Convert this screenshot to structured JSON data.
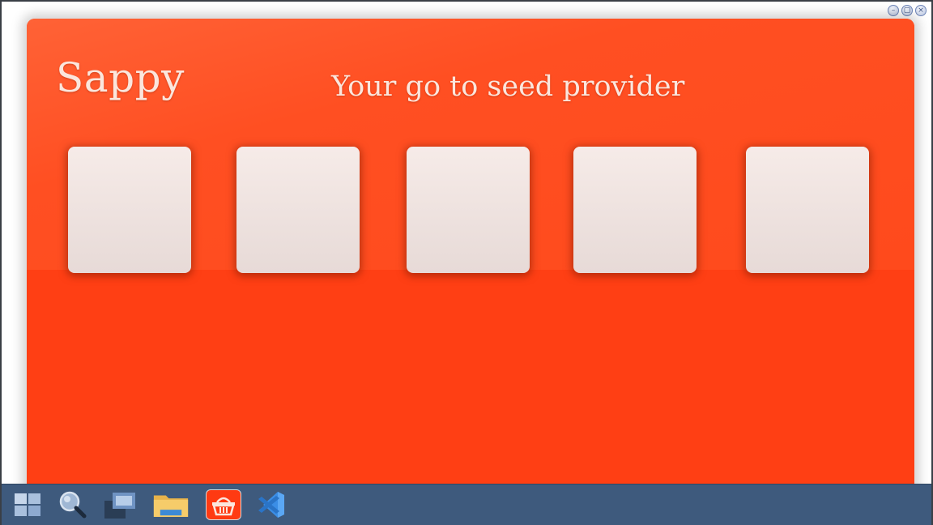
{
  "app": {
    "title": "Sappy",
    "tagline": "Your go to seed provider",
    "colors": {
      "accent": "#ff3f14",
      "header_top": "#ff6236",
      "card_bg": "#f3e8e5",
      "text": "#fbe6dd"
    },
    "cards": [
      {
        "name": "seed-card-1"
      },
      {
        "name": "seed-card-2"
      },
      {
        "name": "seed-card-3"
      },
      {
        "name": "seed-card-4"
      },
      {
        "name": "seed-card-5"
      }
    ]
  },
  "window_controls": {
    "minimize_icon": "minimize-icon",
    "maximize_icon": "maximize-icon",
    "close_icon": "close-icon",
    "minimize_glyph": "–",
    "maximize_glyph": "▢",
    "close_glyph": "×"
  },
  "taskbar": {
    "background": "#3e5a7d",
    "items": [
      {
        "icon": "windows-start-icon"
      },
      {
        "icon": "search-icon"
      },
      {
        "icon": "task-view-icon"
      },
      {
        "icon": "file-explorer-icon"
      },
      {
        "icon": "sappy-basket-icon"
      },
      {
        "icon": "vscode-icon"
      }
    ]
  }
}
